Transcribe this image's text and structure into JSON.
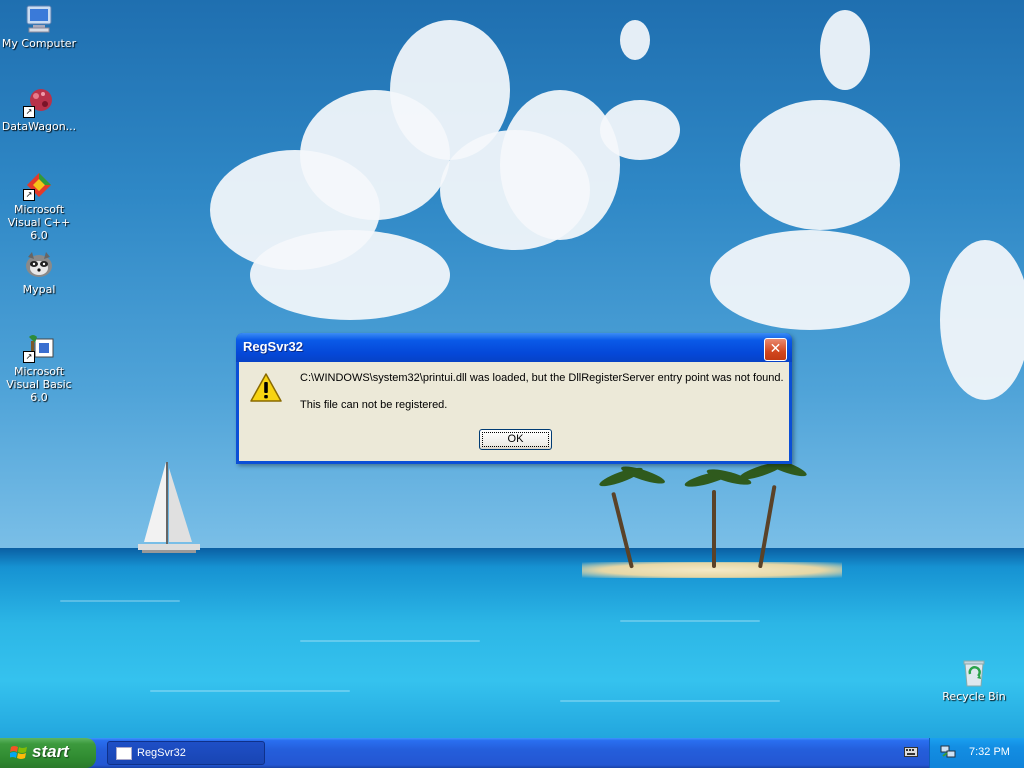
{
  "desktop": {
    "icons": [
      {
        "label": "My Computer",
        "icon": "my-computer-icon"
      },
      {
        "label": "DataWagon...",
        "icon": "datawagon-icon"
      },
      {
        "label": "Microsoft Visual C++ 6.0",
        "icon": "visual-cpp-icon"
      },
      {
        "label": "Mypal",
        "icon": "mypal-raccoon-icon"
      },
      {
        "label": "Microsoft Visual Basic 6.0",
        "icon": "visual-basic-icon"
      },
      {
        "label": "Recycle Bin",
        "icon": "recycle-bin-icon"
      }
    ]
  },
  "dialog": {
    "title": "RegSvr32",
    "message": "C:\\WINDOWS\\system32\\printui.dll was loaded, but the DllRegisterServer entry point was not found.",
    "detail": "This file can not be registered.",
    "ok_label": "OK",
    "icon": "warning-icon",
    "close_icon": "close-icon"
  },
  "taskbar": {
    "start_label": "start",
    "task_items": [
      {
        "label": "RegSvr32",
        "icon": "window-icon"
      }
    ],
    "tray_icons": [
      "keyboard-icon",
      "network-icon"
    ],
    "clock": "7:32 PM"
  },
  "colors": {
    "titlebar": "#0548d8",
    "dialog_bg": "#ece9d8",
    "taskbar": "#245edb",
    "start_button": "#3c9a3d",
    "tray": "#0f83d9"
  }
}
